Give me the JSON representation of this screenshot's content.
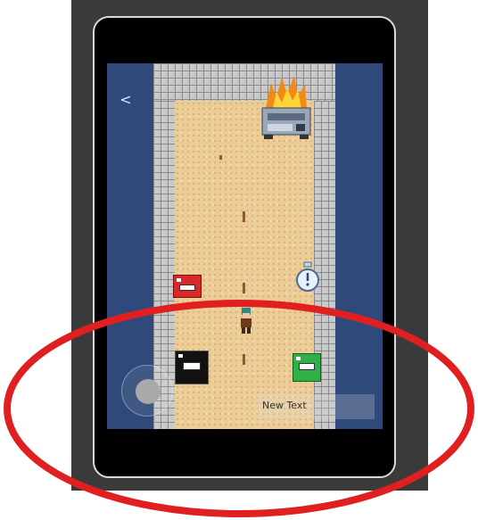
{
  "screen": {
    "back_label": "<",
    "text_panel_label": "New Text"
  },
  "icons": {
    "back": "chevron-left-icon",
    "printer": "burning-printer-icon",
    "timer": "stopwatch-icon",
    "player": "player-character-icon",
    "alarms": [
      "red-alarm-box-icon",
      "black-alarm-box-icon",
      "green-alarm-box-icon"
    ]
  },
  "colors": {
    "screen_bg": "#2f4a7a",
    "floor": "#eccd97",
    "annotation_oval": "#e02020"
  }
}
